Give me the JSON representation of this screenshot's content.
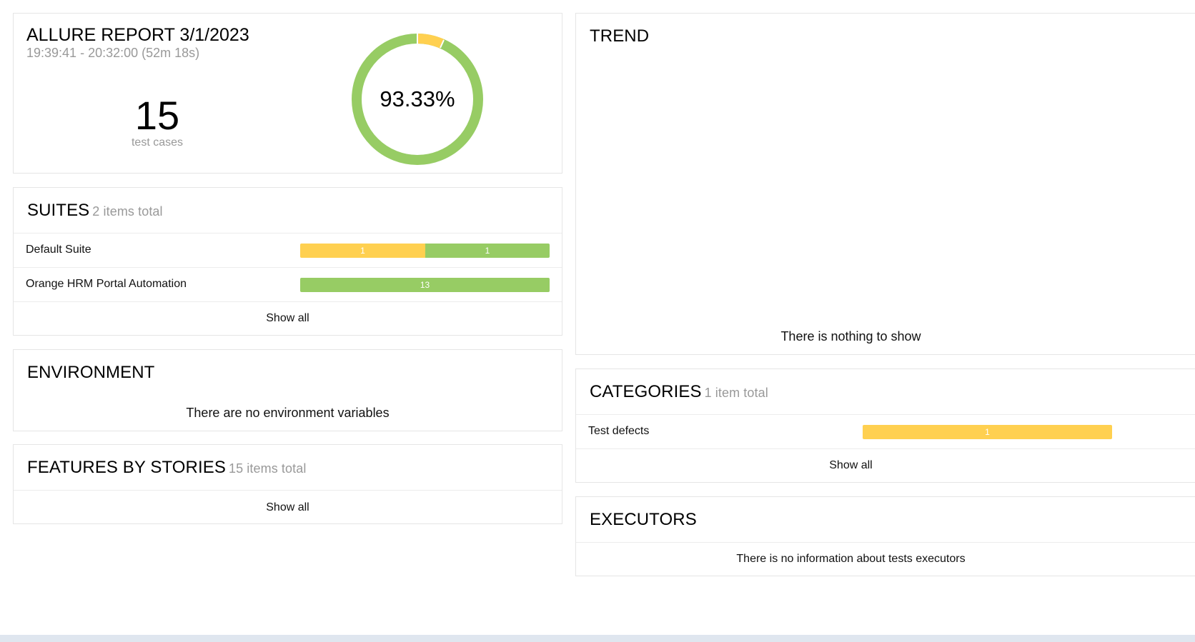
{
  "summary": {
    "title": "ALLURE REPORT 3/1/2023",
    "time_range": "19:39:41 - 20:32:00 (52m 18s)",
    "test_count": "15",
    "test_count_label": "test cases",
    "percent": "93.33%",
    "donut": {
      "broken_fraction": 0.0667,
      "passed_fraction": 0.9333,
      "broken_color": "#ffd050",
      "passed_color": "#97cc64"
    }
  },
  "suites": {
    "title": "SUITES",
    "subtitle": "2 items total",
    "items": [
      {
        "label": "Default Suite",
        "segments": [
          {
            "status": "broken",
            "count": "1"
          },
          {
            "status": "passed",
            "count": "1"
          }
        ]
      },
      {
        "label": "Orange HRM Portal Automation",
        "segments": [
          {
            "status": "passed",
            "count": "13"
          }
        ]
      }
    ],
    "show_all": "Show all"
  },
  "environment": {
    "title": "ENVIRONMENT",
    "message": "There are no environment variables"
  },
  "features": {
    "title": "FEATURES BY STORIES",
    "subtitle": "15 items total",
    "show_all": "Show all"
  },
  "trend": {
    "title": "TREND",
    "message": "There is nothing to show"
  },
  "categories": {
    "title": "CATEGORIES",
    "subtitle": "1 item total",
    "items": [
      {
        "label": "Test defects",
        "segments": [
          {
            "status": "broken",
            "count": "1"
          }
        ]
      }
    ],
    "show_all": "Show all"
  },
  "executors": {
    "title": "EXECUTORS",
    "message": "There is no information about tests executors"
  },
  "colors": {
    "broken": "#ffd050",
    "passed": "#97cc64",
    "border": "#e5e5e5",
    "muted": "#999999"
  }
}
